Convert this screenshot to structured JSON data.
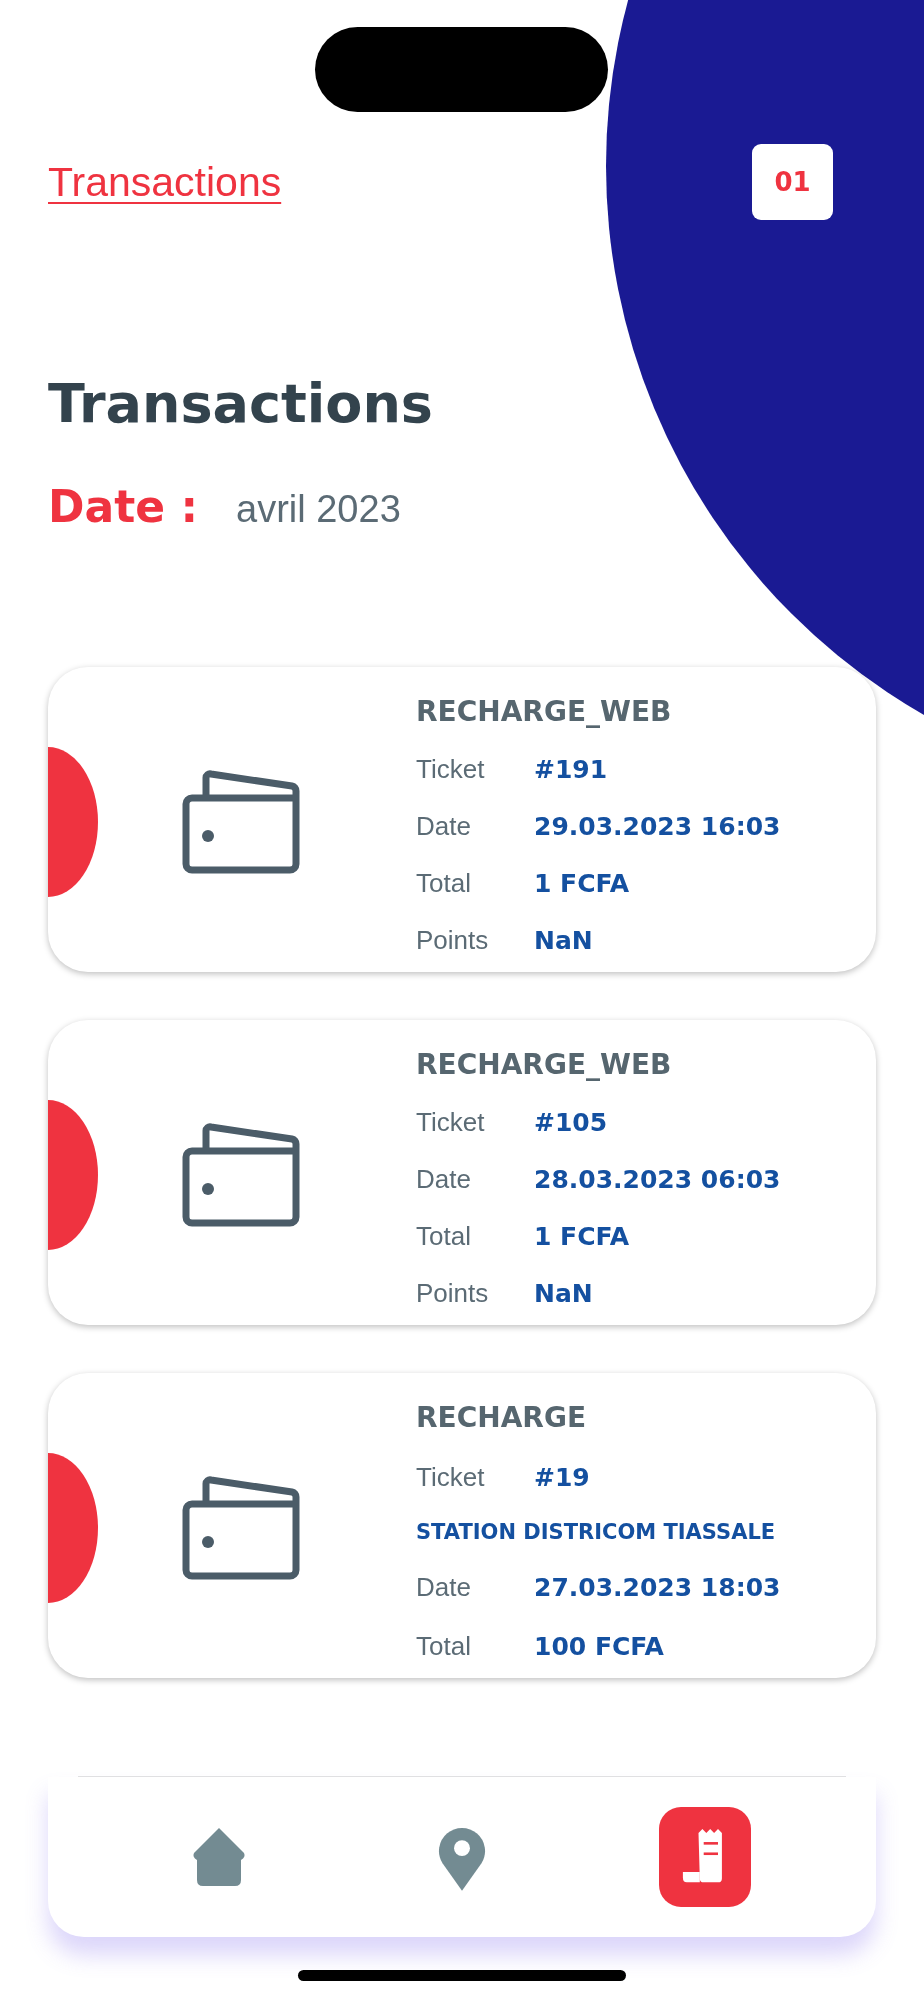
{
  "header": {
    "link": "Transactions",
    "calendar_badge": "01"
  },
  "page": {
    "title": "Transactions",
    "date_label": "Date :",
    "date_value": "avril 2023"
  },
  "transactions": [
    {
      "type": "RECHARGE_WEB",
      "rows": [
        {
          "kind": "field",
          "label": "Ticket",
          "value": "#191"
        },
        {
          "kind": "field",
          "label": "Date",
          "value": "29.03.2023 16:03"
        },
        {
          "kind": "field",
          "label": "Total",
          "value": "1 FCFA"
        },
        {
          "kind": "field",
          "label": "Points",
          "value": "NaN"
        }
      ]
    },
    {
      "type": "RECHARGE_WEB",
      "rows": [
        {
          "kind": "field",
          "label": "Ticket",
          "value": "#105"
        },
        {
          "kind": "field",
          "label": "Date",
          "value": "28.03.2023 06:03"
        },
        {
          "kind": "field",
          "label": "Total",
          "value": "1 FCFA"
        },
        {
          "kind": "field",
          "label": "Points",
          "value": "NaN"
        }
      ]
    },
    {
      "type": "RECHARGE",
      "rows": [
        {
          "kind": "field",
          "label": "Ticket",
          "value": "#19"
        },
        {
          "kind": "line",
          "value": "STATION DISTRICOM TIASSALE"
        },
        {
          "kind": "field",
          "label": "Date",
          "value": "27.03.2023 18:03"
        },
        {
          "kind": "field",
          "label": "Total",
          "value": "100 FCFA"
        }
      ]
    }
  ],
  "nav": [
    {
      "kind": "home",
      "selected": false
    },
    {
      "kind": "location",
      "selected": false
    },
    {
      "kind": "receipt",
      "selected": true
    }
  ]
}
